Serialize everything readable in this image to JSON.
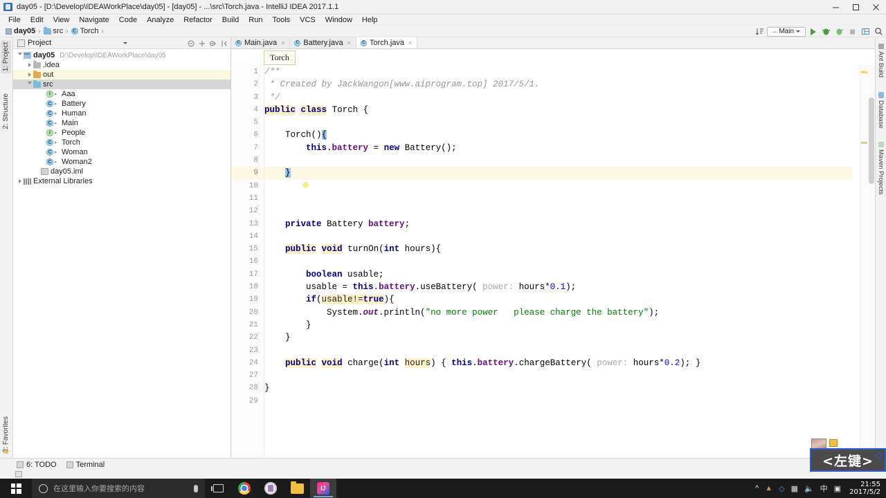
{
  "window": {
    "title": "day05 - [D:\\Develop\\IDEAWorkPlace\\day05] - [day05] - ...\\src\\Torch.java - IntelliJ IDEA 2017.1.1",
    "minimize": "–",
    "maximize": "☐",
    "close": "✕"
  },
  "menu": [
    "File",
    "Edit",
    "View",
    "Navigate",
    "Code",
    "Analyze",
    "Refactor",
    "Build",
    "Run",
    "Tools",
    "VCS",
    "Window",
    "Help"
  ],
  "navbar": {
    "breadcrumbs": [
      {
        "label": "day05",
        "icon": "module-icon",
        "bold": true
      },
      {
        "label": "src",
        "icon": "folder-icon",
        "bold": false
      },
      {
        "label": "Torch",
        "icon": "class-icon",
        "bold": false
      }
    ],
    "separator": "›",
    "run_config": "Main",
    "buttons": [
      {
        "name": "sort-toggle-icon",
        "glyph": "⇅"
      },
      {
        "name": "run-icon",
        "glyph": ""
      },
      {
        "name": "debug-icon",
        "glyph": ""
      },
      {
        "name": "run-coverage-icon",
        "glyph": ""
      },
      {
        "name": "stop-icon",
        "glyph": "■"
      },
      {
        "name": "project-structure-icon",
        "glyph": "⊞"
      },
      {
        "name": "search-everywhere-icon",
        "glyph": "⌕"
      }
    ]
  },
  "left_tool_tabs": [
    {
      "label": "1: Project",
      "selected": true
    },
    {
      "label": "2: Structure",
      "selected": false
    },
    {
      "label": "2: Favorites",
      "selected": false
    }
  ],
  "right_tool_tabs": [
    "Ant Build",
    "Database",
    "Maven Projects"
  ],
  "project_panel": {
    "title": "Project",
    "header_icons": [
      "collapse-all-icon",
      "expand-target-icon",
      "settings-gear-icon",
      "hide-panel-icon"
    ],
    "tree": [
      {
        "label": "day05",
        "sub": "D:\\Develop\\IDEAWorkPlace\\day05",
        "indent": 0,
        "icon": "project-icon",
        "arrow": "open",
        "bold": true,
        "state": "normal"
      },
      {
        "label": ".idea",
        "sub": "",
        "indent": 1,
        "icon": "folder-gray-icon",
        "arrow": "closed",
        "bold": false,
        "state": "normal"
      },
      {
        "label": "out",
        "sub": "",
        "indent": 1,
        "icon": "folder-orange-icon",
        "arrow": "closed",
        "bold": false,
        "state": "highlight"
      },
      {
        "label": "src",
        "sub": "",
        "indent": 1,
        "icon": "folder-blue-icon",
        "arrow": "open",
        "bold": false,
        "state": "selected"
      },
      {
        "label": "Aaa",
        "sub": "",
        "indent": 2,
        "icon": "interface-icon",
        "arrow": "none",
        "bold": false,
        "state": "normal"
      },
      {
        "label": "Battery",
        "sub": "",
        "indent": 2,
        "icon": "class-icon",
        "arrow": "none",
        "bold": false,
        "state": "normal"
      },
      {
        "label": "Human",
        "sub": "",
        "indent": 2,
        "icon": "class-icon",
        "arrow": "none",
        "bold": false,
        "state": "normal"
      },
      {
        "label": "Main",
        "sub": "",
        "indent": 2,
        "icon": "class-runnable-icon",
        "arrow": "none",
        "bold": false,
        "state": "normal"
      },
      {
        "label": "People",
        "sub": "",
        "indent": 2,
        "icon": "interface-icon",
        "arrow": "none",
        "bold": false,
        "state": "normal"
      },
      {
        "label": "Torch",
        "sub": "",
        "indent": 2,
        "icon": "class-icon",
        "arrow": "none",
        "bold": false,
        "state": "normal"
      },
      {
        "label": "Woman",
        "sub": "",
        "indent": 2,
        "icon": "class-icon",
        "arrow": "none",
        "bold": false,
        "state": "normal"
      },
      {
        "label": "Woman2",
        "sub": "",
        "indent": 2,
        "icon": "class-icon",
        "arrow": "none",
        "bold": false,
        "state": "normal"
      },
      {
        "label": "day05.iml",
        "sub": "",
        "indent": 1,
        "icon": "iml-file-icon",
        "arrow": "none",
        "bold": false,
        "state": "normal"
      },
      {
        "label": "External Libraries",
        "sub": "",
        "indent": 0,
        "icon": "library-icon",
        "arrow": "closed",
        "bold": false,
        "state": "normal"
      }
    ]
  },
  "editor": {
    "tabs": [
      {
        "label": "Main.java",
        "active": false
      },
      {
        "label": "Battery.java",
        "active": false
      },
      {
        "label": "Torch.java",
        "active": true
      }
    ],
    "tab_close_glyph": "×",
    "breadcrumb_chip": "Torch",
    "lines": [
      {
        "num": "1",
        "fold": "",
        "current": false
      },
      {
        "num": "2",
        "fold": "",
        "current": false
      },
      {
        "num": "3",
        "fold": "",
        "current": false
      },
      {
        "num": "4",
        "fold": "",
        "current": false
      },
      {
        "num": "5",
        "fold": "",
        "current": false
      },
      {
        "num": "6",
        "fold": "minus",
        "current": false
      },
      {
        "num": "7",
        "fold": "",
        "current": false
      },
      {
        "num": "8",
        "fold": "",
        "current": false
      },
      {
        "num": "9",
        "fold": "",
        "current": true
      },
      {
        "num": "10",
        "fold": "",
        "current": false
      },
      {
        "num": "11",
        "fold": "",
        "current": false
      },
      {
        "num": "12",
        "fold": "",
        "current": false
      },
      {
        "num": "13",
        "fold": "",
        "current": false
      },
      {
        "num": "14",
        "fold": "",
        "current": false
      },
      {
        "num": "15",
        "fold": "minus",
        "current": false
      },
      {
        "num": "16",
        "fold": "",
        "current": false
      },
      {
        "num": "17",
        "fold": "",
        "current": false
      },
      {
        "num": "18",
        "fold": "",
        "current": false
      },
      {
        "num": "19",
        "fold": "",
        "current": false
      },
      {
        "num": "20",
        "fold": "",
        "current": false
      },
      {
        "num": "21",
        "fold": "",
        "current": false
      },
      {
        "num": "22",
        "fold": "",
        "current": false
      },
      {
        "num": "23",
        "fold": "",
        "current": false
      },
      {
        "num": "24",
        "fold": "plus",
        "current": false
      },
      {
        "num": "27",
        "fold": "",
        "current": false
      },
      {
        "num": "28",
        "fold": "",
        "current": false
      },
      {
        "num": "29",
        "fold": "",
        "current": false
      }
    ],
    "code_text": [
      "/**",
      " * Created by JackWangon[www.aiprogram.top] 2017/5/1.",
      " */",
      "public class Torch {",
      "",
      "    Torch(){",
      "        this.battery = new Battery();",
      "",
      "    }",
      "",
      "",
      "",
      "    private Battery battery;",
      "",
      "    public void turnOn(int hours){",
      "",
      "        boolean usable;",
      "        usable = this.battery.useBattery( power: hours*0.1);",
      "        if(usable!=true){",
      "            System.out.println(\"no more power   please charge the battery\");",
      "        }",
      "    }",
      "",
      "    public void charge(int hours) { this.battery.chargeBattery( power: hours*0.2); }",
      "",
      "}",
      ""
    ]
  },
  "bottom_bar": {
    "items": [
      {
        "label": "6: TODO",
        "icon": "todo-icon"
      },
      {
        "label": "Terminal",
        "icon": "terminal-icon"
      }
    ]
  },
  "overlay": {
    "click_label": "<左键>"
  },
  "taskbar": {
    "search_placeholder": "在这里输入你要搜索的内容",
    "apps": [
      {
        "name": "task-view-icon"
      },
      {
        "name": "chrome-icon"
      },
      {
        "name": "app-icon"
      },
      {
        "name": "file-explorer-icon"
      },
      {
        "name": "intellij-idea-icon",
        "active": true
      }
    ],
    "tray": [
      "∧",
      "⛺",
      "✉",
      "❖",
      "⦿",
      "中",
      "▣"
    ],
    "time": "21:55",
    "date": "2017/5/2"
  },
  "colors": {
    "accent": "#2b5dd0",
    "keyword": "#000080",
    "string": "#008000",
    "comment": "#969696",
    "field": "#660e7a",
    "number": "#0000ff",
    "highlight_line": "#fcf8e3",
    "brace_match": "#9bc4f0"
  }
}
